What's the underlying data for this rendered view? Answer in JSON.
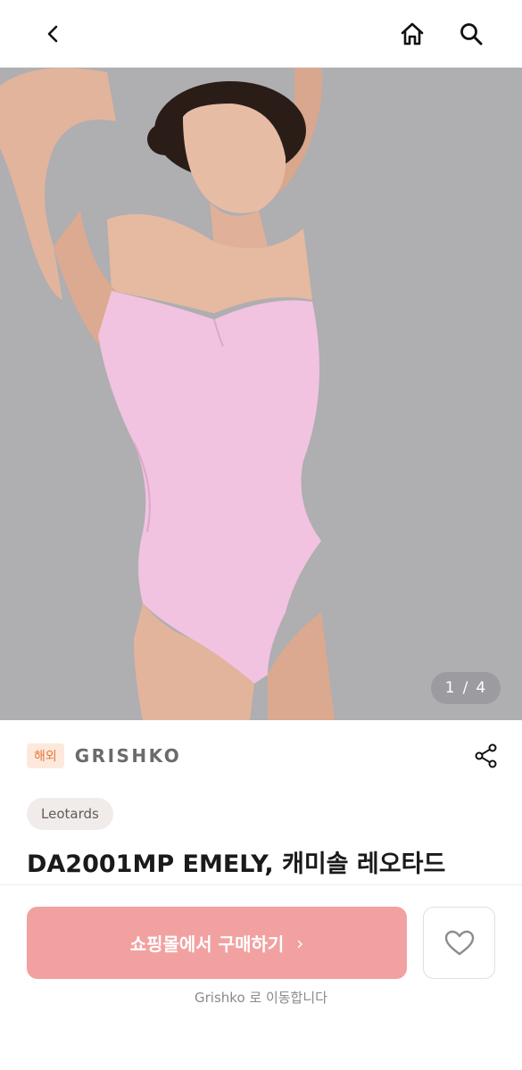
{
  "header": {
    "back_icon": "chevron-left-icon",
    "home_icon": "home-icon",
    "search_icon": "search-icon"
  },
  "gallery": {
    "current": "1",
    "separator": "/",
    "total": "4"
  },
  "product": {
    "overseas_badge": "해외",
    "brand": "GRISHKO",
    "category": "Leotards",
    "title": "DA2001MP EMELY, 캐미솔 레오타드",
    "share_icon": "share-icon"
  },
  "actions": {
    "buy_label": "쇼핑몰에서 구매하기",
    "buy_chevron": "›",
    "wishlist_icon": "heart-icon",
    "redirect_note": "Grishko 로 이동합니다"
  },
  "colors": {
    "buy_button": "#f2a1a1",
    "badge_text": "#e8773f",
    "badge_bg": "#fde9dc",
    "hero_bg": "#afaeb1"
  }
}
